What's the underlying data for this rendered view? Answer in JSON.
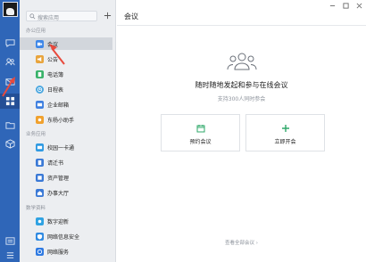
{
  "sidebar_panel": {
    "search_placeholder": "搜索应用",
    "sections": [
      {
        "title": "办公应用",
        "items": [
          {
            "label": "会议",
            "icon": "video-camera-icon",
            "color": "#3d86e8",
            "selected": true
          },
          {
            "label": "公告",
            "icon": "megaphone-icon",
            "color": "#e8a43d"
          },
          {
            "label": "电话簿",
            "icon": "contacts-book-icon",
            "color": "#39b26a"
          },
          {
            "label": "日程表",
            "icon": "calendar-clock-icon",
            "color": "#4aa7e0"
          },
          {
            "label": "企业邮箱",
            "icon": "mail-icon",
            "color": "#3e7fe0"
          },
          {
            "label": "东杨小助手",
            "icon": "assistant-icon",
            "color": "#f0a12e"
          }
        ]
      },
      {
        "title": "业务应用",
        "items": [
          {
            "label": "校园一卡通",
            "icon": "card-icon",
            "color": "#2f9ae2"
          },
          {
            "label": "请迁书",
            "icon": "document-icon",
            "color": "#3a79d6"
          },
          {
            "label": "资产管理",
            "icon": "asset-icon",
            "color": "#3a79d6"
          },
          {
            "label": "办事大厅",
            "icon": "hall-icon",
            "color": "#3a79d6"
          }
        ]
      },
      {
        "title": "数学资料",
        "items": [
          {
            "label": "数字迎新",
            "icon": "welcome-icon",
            "color": "#2fa2e2"
          },
          {
            "label": "网络信息安全",
            "icon": "shield-icon",
            "color": "#2f8ae2"
          },
          {
            "label": "网络服务",
            "icon": "network-icon",
            "color": "#2f7ae2"
          }
        ]
      }
    ]
  },
  "main": {
    "title": "会议",
    "headline": "随时随地发起和参与在线会议",
    "subline": "支持300人同时参会",
    "cards": [
      {
        "label": "预约会议",
        "icon": "schedule-icon"
      },
      {
        "label": "立即开会",
        "icon": "start-meeting-icon"
      }
    ],
    "footer_link": "查看全部会议 ›"
  },
  "colors": {
    "rail": "#2f66b8",
    "accent": "#3d86e8",
    "arrow": "#e84a3d"
  }
}
